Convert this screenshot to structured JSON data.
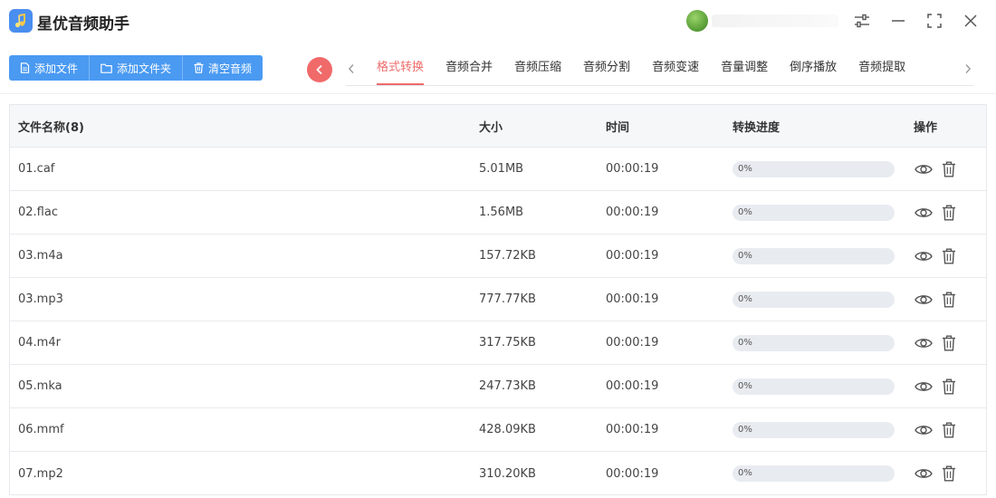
{
  "app": {
    "title": "星优音频助手"
  },
  "toolbar": {
    "add_file": "添加文件",
    "add_folder": "添加文件夹",
    "clear_audio": "清空音频"
  },
  "tabs": [
    {
      "label": "格式转换",
      "active": true
    },
    {
      "label": "音频合并",
      "active": false
    },
    {
      "label": "音频压缩",
      "active": false
    },
    {
      "label": "音频分割",
      "active": false
    },
    {
      "label": "音频变速",
      "active": false
    },
    {
      "label": "音量调整",
      "active": false
    },
    {
      "label": "倒序播放",
      "active": false
    },
    {
      "label": "音频提取",
      "active": false
    }
  ],
  "table": {
    "headers": {
      "name": "文件名称(8)",
      "size": "大小",
      "time": "时间",
      "progress": "转换进度",
      "actions": "操作"
    },
    "rows": [
      {
        "name": "01.caf",
        "size": "5.01MB",
        "time": "00:00:19",
        "progress": 0,
        "progress_label": "0%"
      },
      {
        "name": "02.flac",
        "size": "1.56MB",
        "time": "00:00:19",
        "progress": 0,
        "progress_label": "0%"
      },
      {
        "name": "03.m4a",
        "size": "157.72KB",
        "time": "00:00:19",
        "progress": 0,
        "progress_label": "0%"
      },
      {
        "name": "03.mp3",
        "size": "777.77KB",
        "time": "00:00:19",
        "progress": 0,
        "progress_label": "0%"
      },
      {
        "name": "04.m4r",
        "size": "317.75KB",
        "time": "00:00:19",
        "progress": 0,
        "progress_label": "0%"
      },
      {
        "name": "05.mka",
        "size": "247.73KB",
        "time": "00:00:19",
        "progress": 0,
        "progress_label": "0%"
      },
      {
        "name": "06.mmf",
        "size": "428.09KB",
        "time": "00:00:19",
        "progress": 0,
        "progress_label": "0%"
      },
      {
        "name": "07.mp2",
        "size": "310.20KB",
        "time": "00:00:19",
        "progress": 0,
        "progress_label": "0%"
      }
    ]
  },
  "colors": {
    "accent": "#4a9af2",
    "active_tab": "#ef6b6b",
    "collapse_button": "#f06a6a"
  },
  "icons": {
    "row_actions": [
      "eye-icon",
      "trash-icon"
    ],
    "window": [
      "settings-sliders-icon",
      "minimize-icon",
      "fullscreen-icon",
      "close-icon"
    ]
  }
}
